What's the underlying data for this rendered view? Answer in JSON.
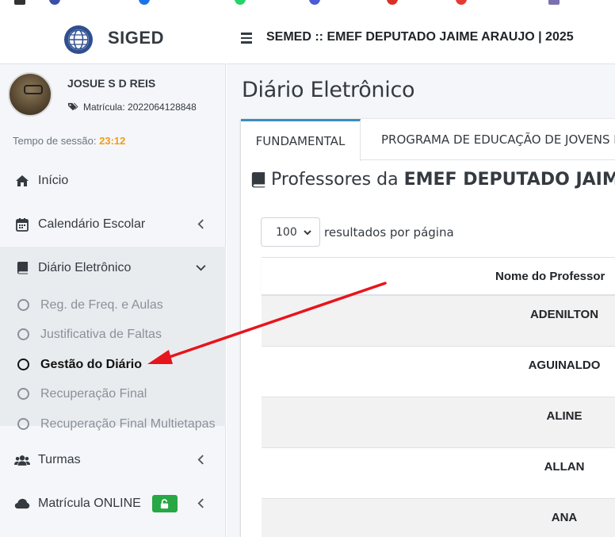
{
  "app": {
    "brand": "SIGED",
    "header_title": "SEMED :: EMEF DEPUTADO JAIME ARAUJO | 2025"
  },
  "user": {
    "name": "JOSUE S D REIS",
    "registration": "Matrícula: 2022064128848"
  },
  "session": {
    "label": "Tempo de sessão:",
    "time": "23:12"
  },
  "sidebar": {
    "items": [
      {
        "label": "Início",
        "icon": "home-icon"
      },
      {
        "label": "Calendário Escolar",
        "icon": "calendar-icon"
      },
      {
        "label": "Diário Eletrônico",
        "icon": "book-icon"
      },
      {
        "label": "Turmas",
        "icon": "users-icon"
      },
      {
        "label": "Matrícula ONLINE",
        "icon": "cloud-icon"
      }
    ],
    "submenu": [
      {
        "label": "Reg. de Freq. e Aulas"
      },
      {
        "label": "Justificativa de Faltas"
      },
      {
        "label": "Gestão do Diário"
      },
      {
        "label": "Recuperação Final"
      },
      {
        "label": "Recuperação Final Multietapas"
      }
    ]
  },
  "main": {
    "page_title": "Diário Eletrônico",
    "tabs": [
      {
        "label": "FUNDAMENTAL"
      },
      {
        "label": "PROGRAMA DE EDUCAÇÃO DE JOVENS E"
      }
    ],
    "heading_prefix": "Professores da",
    "heading_school": "EMEF DEPUTADO JAIME A",
    "page_size": "100",
    "page_size_suffix": "resultados por página",
    "table": {
      "column_header": "Nome do Professor",
      "rows": [
        "ADENILTON",
        "AGUINALDO",
        "ALINE",
        "ALLAN",
        "ANA"
      ]
    }
  },
  "colors": {
    "accent_tab": "#3c8dbc",
    "session_time": "#f39c12",
    "lock_badge": "#28a745",
    "annotation_arrow": "#e8141b"
  }
}
